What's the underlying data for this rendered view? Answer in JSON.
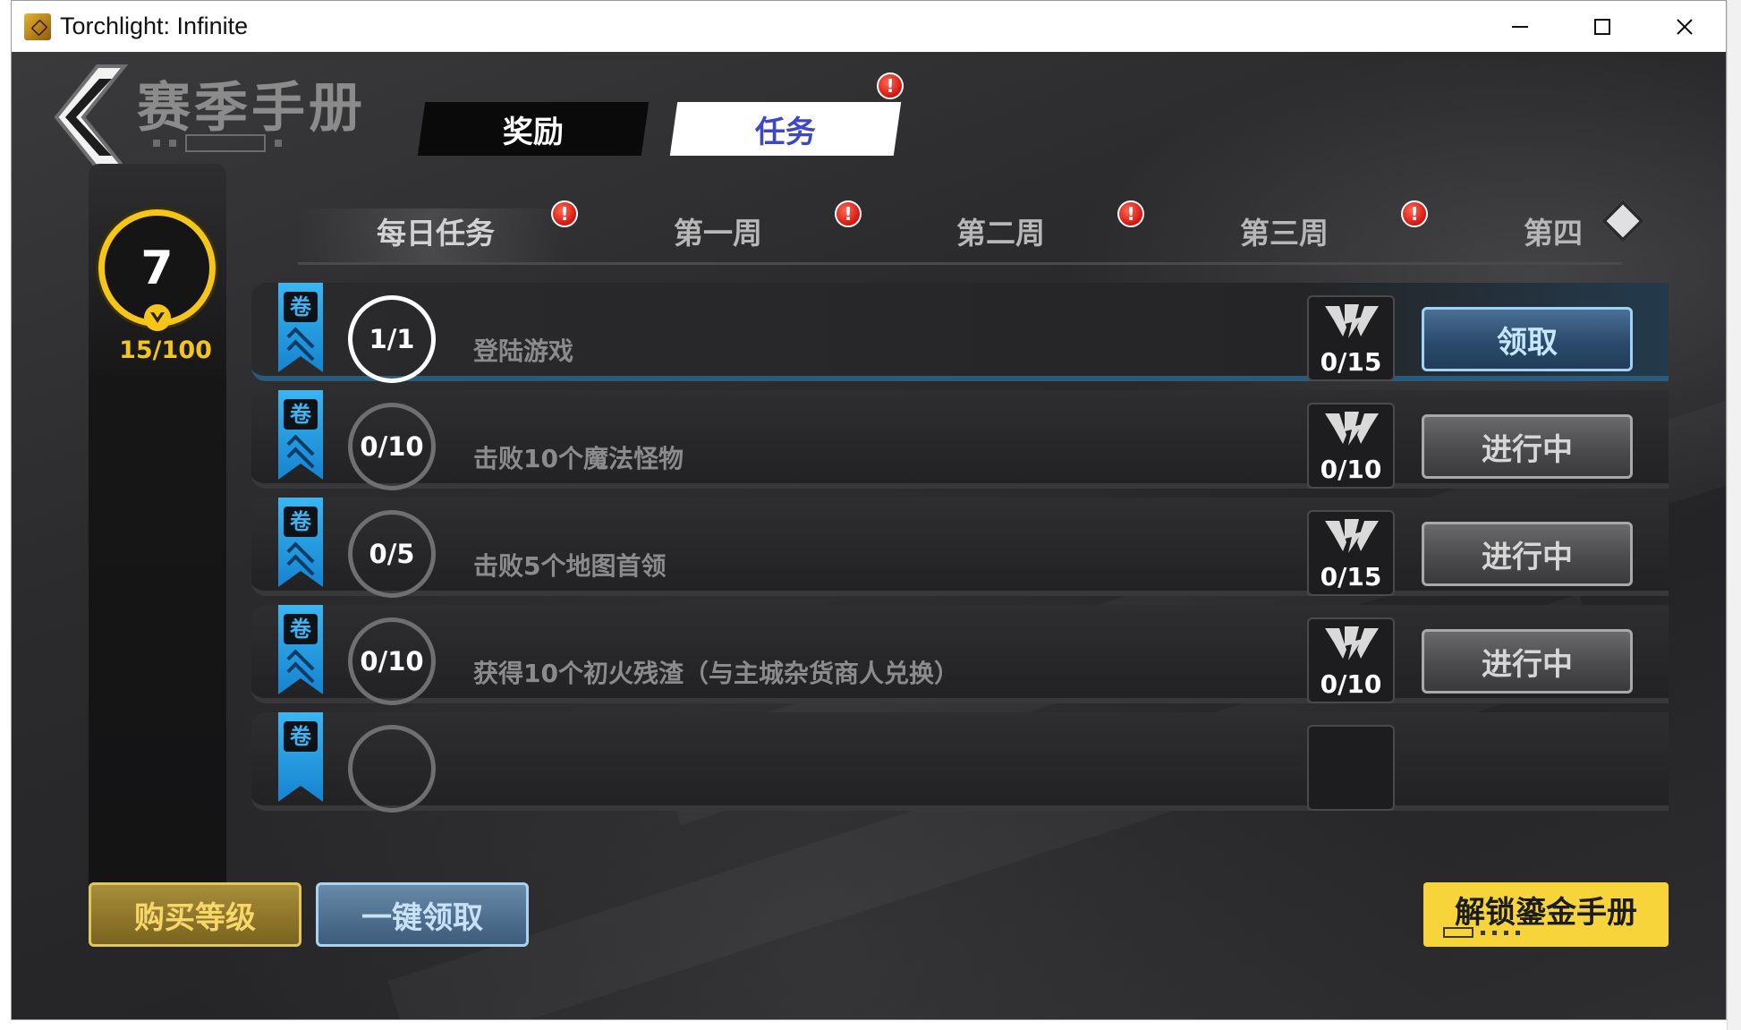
{
  "window": {
    "title": "Torchlight: Infinite",
    "controls": [
      "minimize",
      "maximize",
      "close"
    ]
  },
  "header": {
    "page_title": "赛季手册",
    "tabs": [
      {
        "label": "奖励",
        "active": false,
        "alert": false
      },
      {
        "label": "任务",
        "active": true,
        "alert": true
      }
    ]
  },
  "level": {
    "value": "7",
    "exp": "15/100"
  },
  "subtabs": [
    {
      "label": "每日任务",
      "active": true,
      "alert": true
    },
    {
      "label": "第一周",
      "active": false,
      "alert": true
    },
    {
      "label": "第二周",
      "active": false,
      "alert": true
    },
    {
      "label": "第三周",
      "active": false,
      "alert": true
    },
    {
      "label": "第四",
      "active": false,
      "alert": false
    }
  ],
  "tasks": [
    {
      "progress": "1/1",
      "name": "登陆游戏",
      "reward": "0/15",
      "action": "领取",
      "state": "claimable"
    },
    {
      "progress": "0/10",
      "name": "击败10个魔法怪物",
      "reward": "0/10",
      "action": "进行中",
      "state": "in-progress"
    },
    {
      "progress": "0/5",
      "name": "击败5个地图首领",
      "reward": "0/15",
      "action": "进行中",
      "state": "in-progress"
    },
    {
      "progress": "0/10",
      "name": "获得10个初火残渣（与主城杂货商人兑换）",
      "reward": "0/10",
      "action": "进行中",
      "state": "in-progress"
    }
  ],
  "footer": {
    "buy_level": "购买等级",
    "claim_all": "一键领取",
    "unlock_premium": "解锁鎏金手册"
  },
  "colors": {
    "accent_gold": "#f5c518",
    "ribbon_blue": "#3ab6f2",
    "alert_red": "#d3140f",
    "tab_active_text": "#3d47c8"
  },
  "icons": {
    "alert": "!",
    "ribbon": "quest-scroll",
    "reward": "season-crest"
  }
}
